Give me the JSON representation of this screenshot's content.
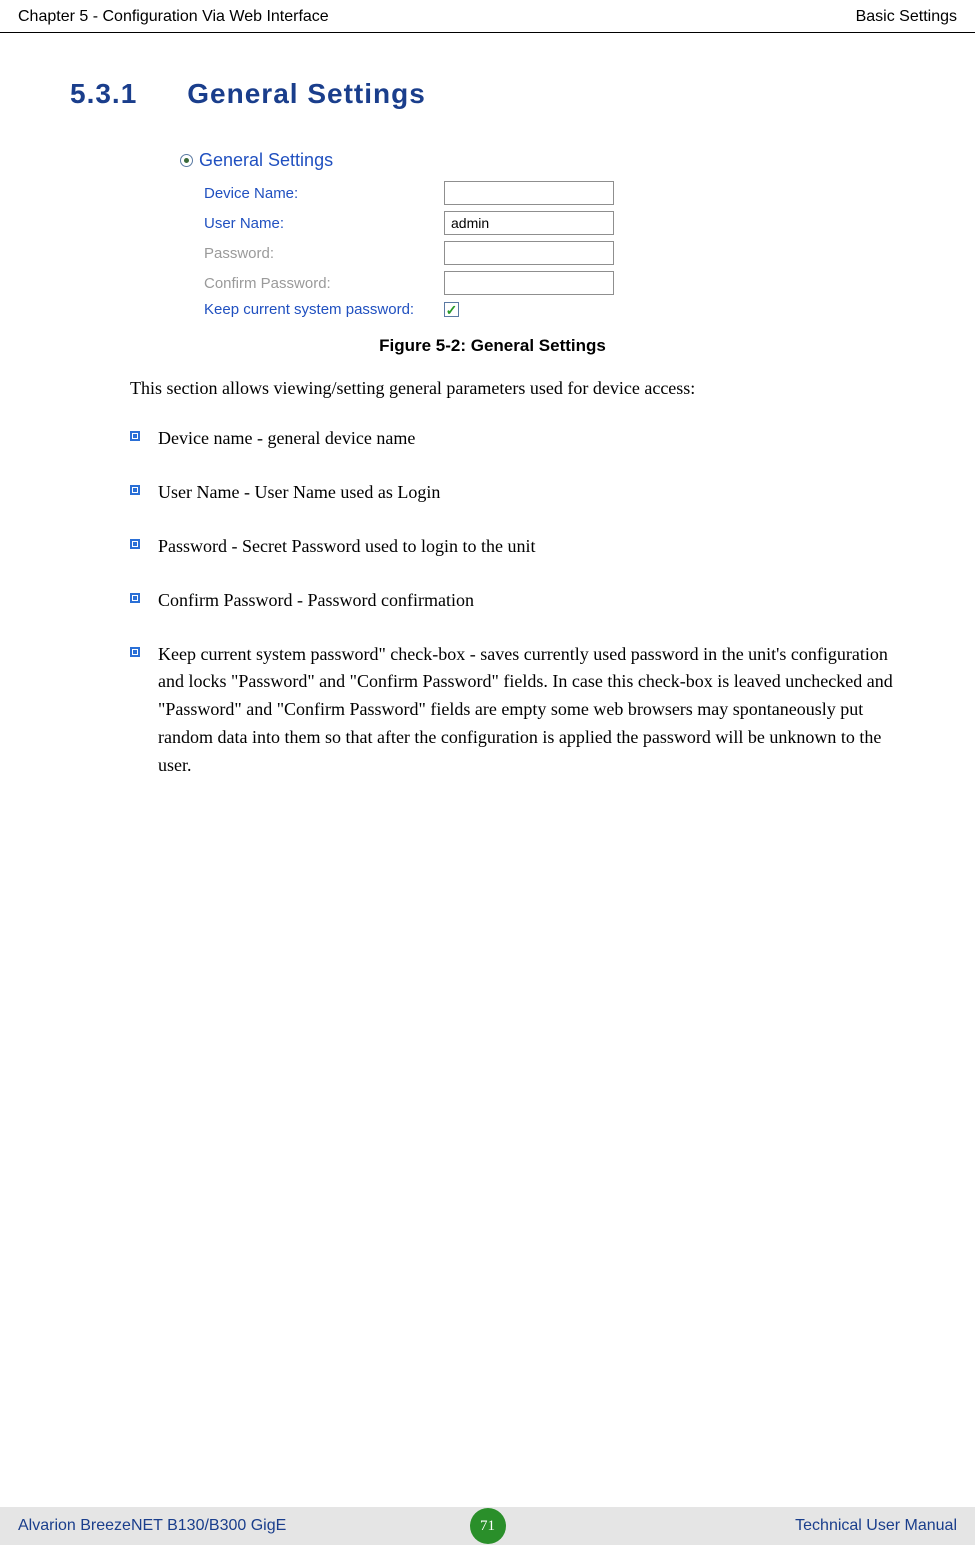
{
  "header": {
    "left": "Chapter 5 - Configuration Via Web Interface",
    "right": "Basic Settings"
  },
  "section": {
    "number": "5.3.1",
    "title": "General Settings"
  },
  "figure": {
    "panel_title": "General Settings",
    "rows": {
      "device_name": {
        "label": "Device Name:",
        "value": ""
      },
      "user_name": {
        "label": "User Name:",
        "value": "admin"
      },
      "password": {
        "label": "Password:",
        "value": ""
      },
      "confirm": {
        "label": "Confirm Password:",
        "value": ""
      },
      "keep": {
        "label": "Keep current system password:",
        "checked": "✓"
      }
    },
    "caption": "Figure 5-2: General Settings"
  },
  "intro": "This section allows viewing/setting general parameters used for device access:",
  "bullets": [
    "Device name - general device name",
    "User Name - User Name used as Login",
    "Password - Secret Password used to login to the unit",
    "Confirm Password - Password confirmation",
    "Keep current system password\" check-box - saves currently used password in the unit's configuration and locks \"Password\" and \"Confirm Password\" fields. In case this check-box is leaved unchecked and \"Password\" and \"Confirm Password\" fields are empty some web browsers may spontaneously put random data into them so that after the configuration is applied the password will be unknown to the user."
  ],
  "footer": {
    "left": "Alvarion BreezeNET B130/B300 GigE",
    "page": "71",
    "right": "Technical User Manual"
  }
}
